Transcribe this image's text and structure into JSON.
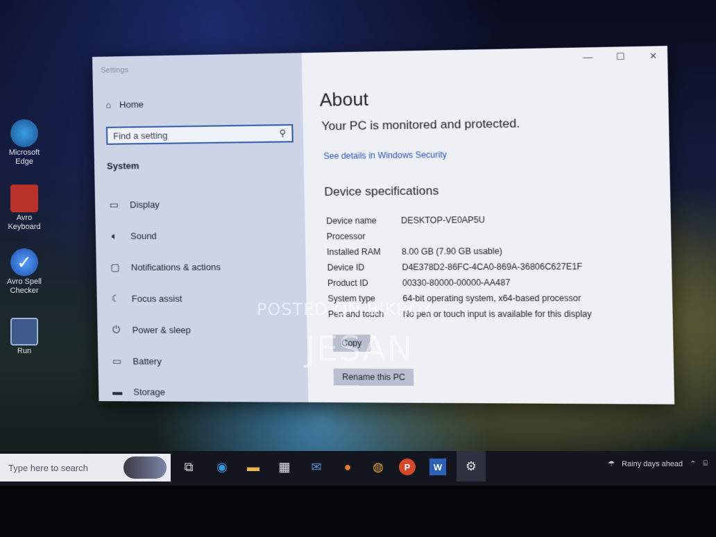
{
  "desktop_icons": [
    {
      "label": "Microsoft Edge",
      "icon": "edge-icon",
      "color": "#2b8fd6"
    },
    {
      "label": "Avro Keyboard",
      "icon": "keyboard-icon",
      "color": "#c0392b"
    },
    {
      "label": "Avro Spell Checker",
      "icon": "spellcheck-icon",
      "color": "#2a6fd6"
    },
    {
      "label": "Run",
      "icon": "run-icon",
      "color": "#3b5b8c"
    }
  ],
  "window": {
    "title": "Settings",
    "controls": [
      "—",
      "☐",
      "✕"
    ]
  },
  "sidebar": {
    "home_label": "Home",
    "search_placeholder": "Find a setting",
    "section_label": "System",
    "items": [
      {
        "label": "Display",
        "icon": "monitor-icon"
      },
      {
        "label": "Sound",
        "icon": "speaker-icon"
      },
      {
        "label": "Notifications & actions",
        "icon": "notification-icon"
      },
      {
        "label": "Focus assist",
        "icon": "moon-icon"
      },
      {
        "label": "Power & sleep",
        "icon": "power-icon"
      },
      {
        "label": "Battery",
        "icon": "battery-icon"
      },
      {
        "label": "Storage",
        "icon": "storage-icon"
      }
    ]
  },
  "about": {
    "title": "About",
    "protection_status": "Your PC is monitored and protected.",
    "security_link": "See details in Windows Security",
    "specs_heading": "Device specifications",
    "specs": [
      {
        "key": "Device name",
        "value": "DESKTOP-VE0AP5U"
      },
      {
        "key": "Processor",
        "value": ""
      },
      {
        "key": "Installed RAM",
        "value": "8.00 GB (7.90 GB usable)"
      },
      {
        "key": "Device ID",
        "value": "D4E378D2-86FC-4CA0-869A-36806C627E1F"
      },
      {
        "key": "Product ID",
        "value": "00330-80000-00000-AA487"
      },
      {
        "key": "System type",
        "value": "64-bit operating system, x64-based processor"
      },
      {
        "key": "Pen and touch",
        "value": "No pen or touch input is available for this display"
      }
    ],
    "copy_button": "Copy",
    "rename_button": "Rename this PC"
  },
  "watermarks": {
    "posted": "POSTED ON BIKROY",
    "name": "JESAN"
  },
  "taskbar": {
    "search_placeholder": "Type here to search",
    "apps": [
      {
        "name": "task-view-icon",
        "glyph": "⧉",
        "color": "#d8dbe4"
      },
      {
        "name": "edge-icon",
        "glyph": "◉",
        "color": "#2b9be0"
      },
      {
        "name": "file-explorer-icon",
        "glyph": "▬",
        "color": "#e8b64a"
      },
      {
        "name": "store-icon",
        "glyph": "▦",
        "color": "#e6e8ee"
      },
      {
        "name": "mail-icon",
        "glyph": "✉",
        "color": "#4a8fd8"
      },
      {
        "name": "firefox-icon",
        "glyph": "●",
        "color": "#e8772a"
      },
      {
        "name": "chrome-icon",
        "glyph": "◍",
        "color": "#e0a030"
      },
      {
        "name": "powerpoint-icon",
        "glyph": "P",
        "color": "#d24a2a"
      },
      {
        "name": "word-icon",
        "glyph": "W",
        "color": "#2b5fb8"
      },
      {
        "name": "settings-icon",
        "glyph": "⚙",
        "color": "#e6e8ee"
      }
    ],
    "weather_text": "Rainy days ahead"
  }
}
